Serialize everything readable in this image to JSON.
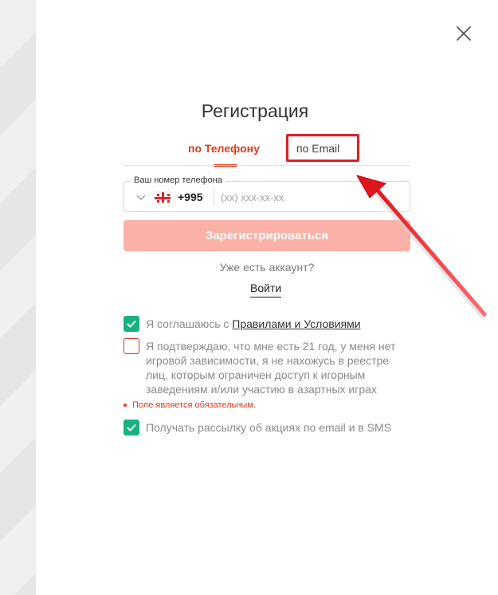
{
  "modal": {
    "title": "Регистрация"
  },
  "tabs": [
    {
      "label": "по Телефону",
      "active": true
    },
    {
      "label": "по Email",
      "active": false
    }
  ],
  "phone": {
    "legend": "Ваш номер телефона",
    "country_code": "+995",
    "country_flag": "georgia-flag-icon",
    "placeholder": "(xx) xxx-xx-xx",
    "value": ""
  },
  "register_button": {
    "label": "Зарегистрироваться"
  },
  "account": {
    "question": "Уже есть аккаунт?",
    "login_label": "Войти"
  },
  "agreements": {
    "terms_prefix": "Я соглашаюсь с ",
    "terms_link": "Правилами и Условиями",
    "terms_checked": true,
    "age_text": "Я подтверждаю, что мне есть 21 год, у меня нет игровой зависимости, я не нахожусь в реестре лиц, которым ограничен доступ к игорным заведениям и/или участию в азартных играх",
    "age_checked": false,
    "error_text": "Поле является обязательным.",
    "newsletter_text": "Получать рассылку об акциях по email и в SMS",
    "newsletter_checked": true
  },
  "colors": {
    "accent": "#e43b1a",
    "button_disabled": "#fbb1a8",
    "checkbox_checked": "#16b37f",
    "annotation_red": "#dd1f2a"
  }
}
